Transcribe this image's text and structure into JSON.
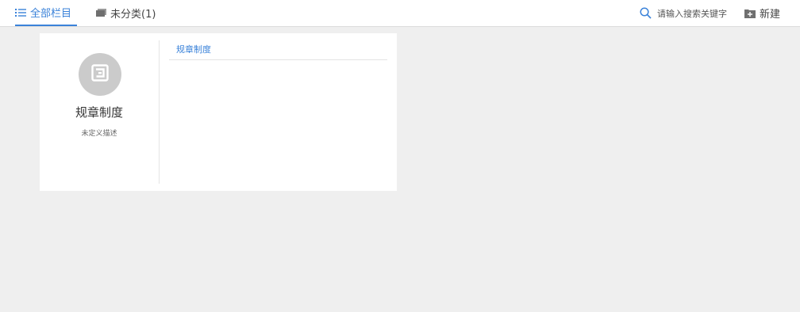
{
  "topbar": {
    "tabs": [
      {
        "label": "全部栏目",
        "icon": "list-icon",
        "active": true
      },
      {
        "label": "未分类(1)",
        "icon": "folder-icon",
        "active": false
      }
    ],
    "search": {
      "placeholder": "请输入搜索关键字",
      "icon": "search-icon"
    },
    "new_button": {
      "label": "新建",
      "icon": "add-folder-icon"
    }
  },
  "card": {
    "icon": "category-icon",
    "title": "规章制度",
    "description": "未定义描述",
    "children": [
      "规章制度"
    ]
  },
  "colors": {
    "accent": "#3a82d9",
    "background": "#efefef",
    "avatar": "#cbcbcb"
  }
}
